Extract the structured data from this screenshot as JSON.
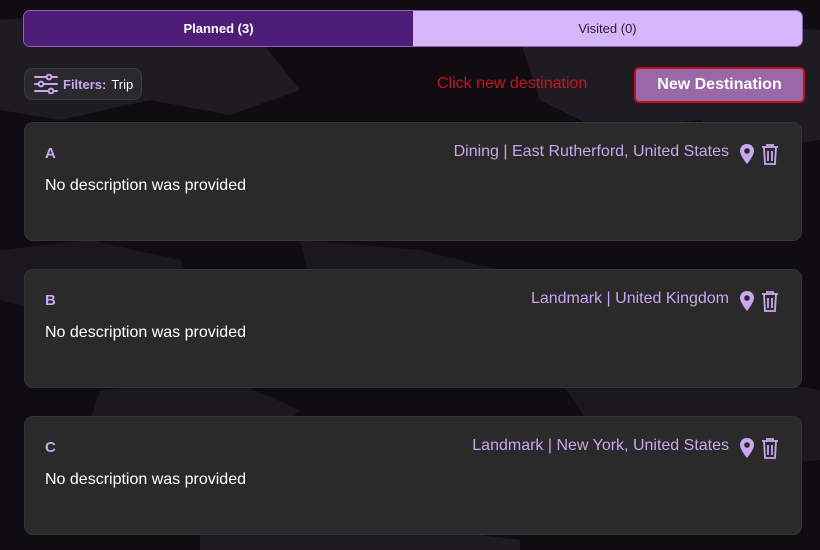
{
  "tabs": [
    {
      "label": "Planned (3)",
      "active": true
    },
    {
      "label": "Visited (0)",
      "active": false
    }
  ],
  "filters": {
    "label": "Filters:",
    "value": "Trip",
    "icon": "sliders-icon"
  },
  "hint": "Click new destination",
  "new_button": {
    "label": "New Destination"
  },
  "cards": [
    {
      "title": "A",
      "meta": "Dining | East Rutherford, United States",
      "description": "No description was provided"
    },
    {
      "title": "B",
      "meta": "Landmark | United Kingdom",
      "description": "No description was provided"
    },
    {
      "title": "C",
      "meta": "Landmark | New York, United States",
      "description": "No description was provided"
    }
  ],
  "colors": {
    "accent": "#c9a6ef",
    "active_tab": "#4d1d78",
    "inactive_tab": "#d6b6fb",
    "button": "#9a67a8",
    "alert": "#c8141e"
  }
}
